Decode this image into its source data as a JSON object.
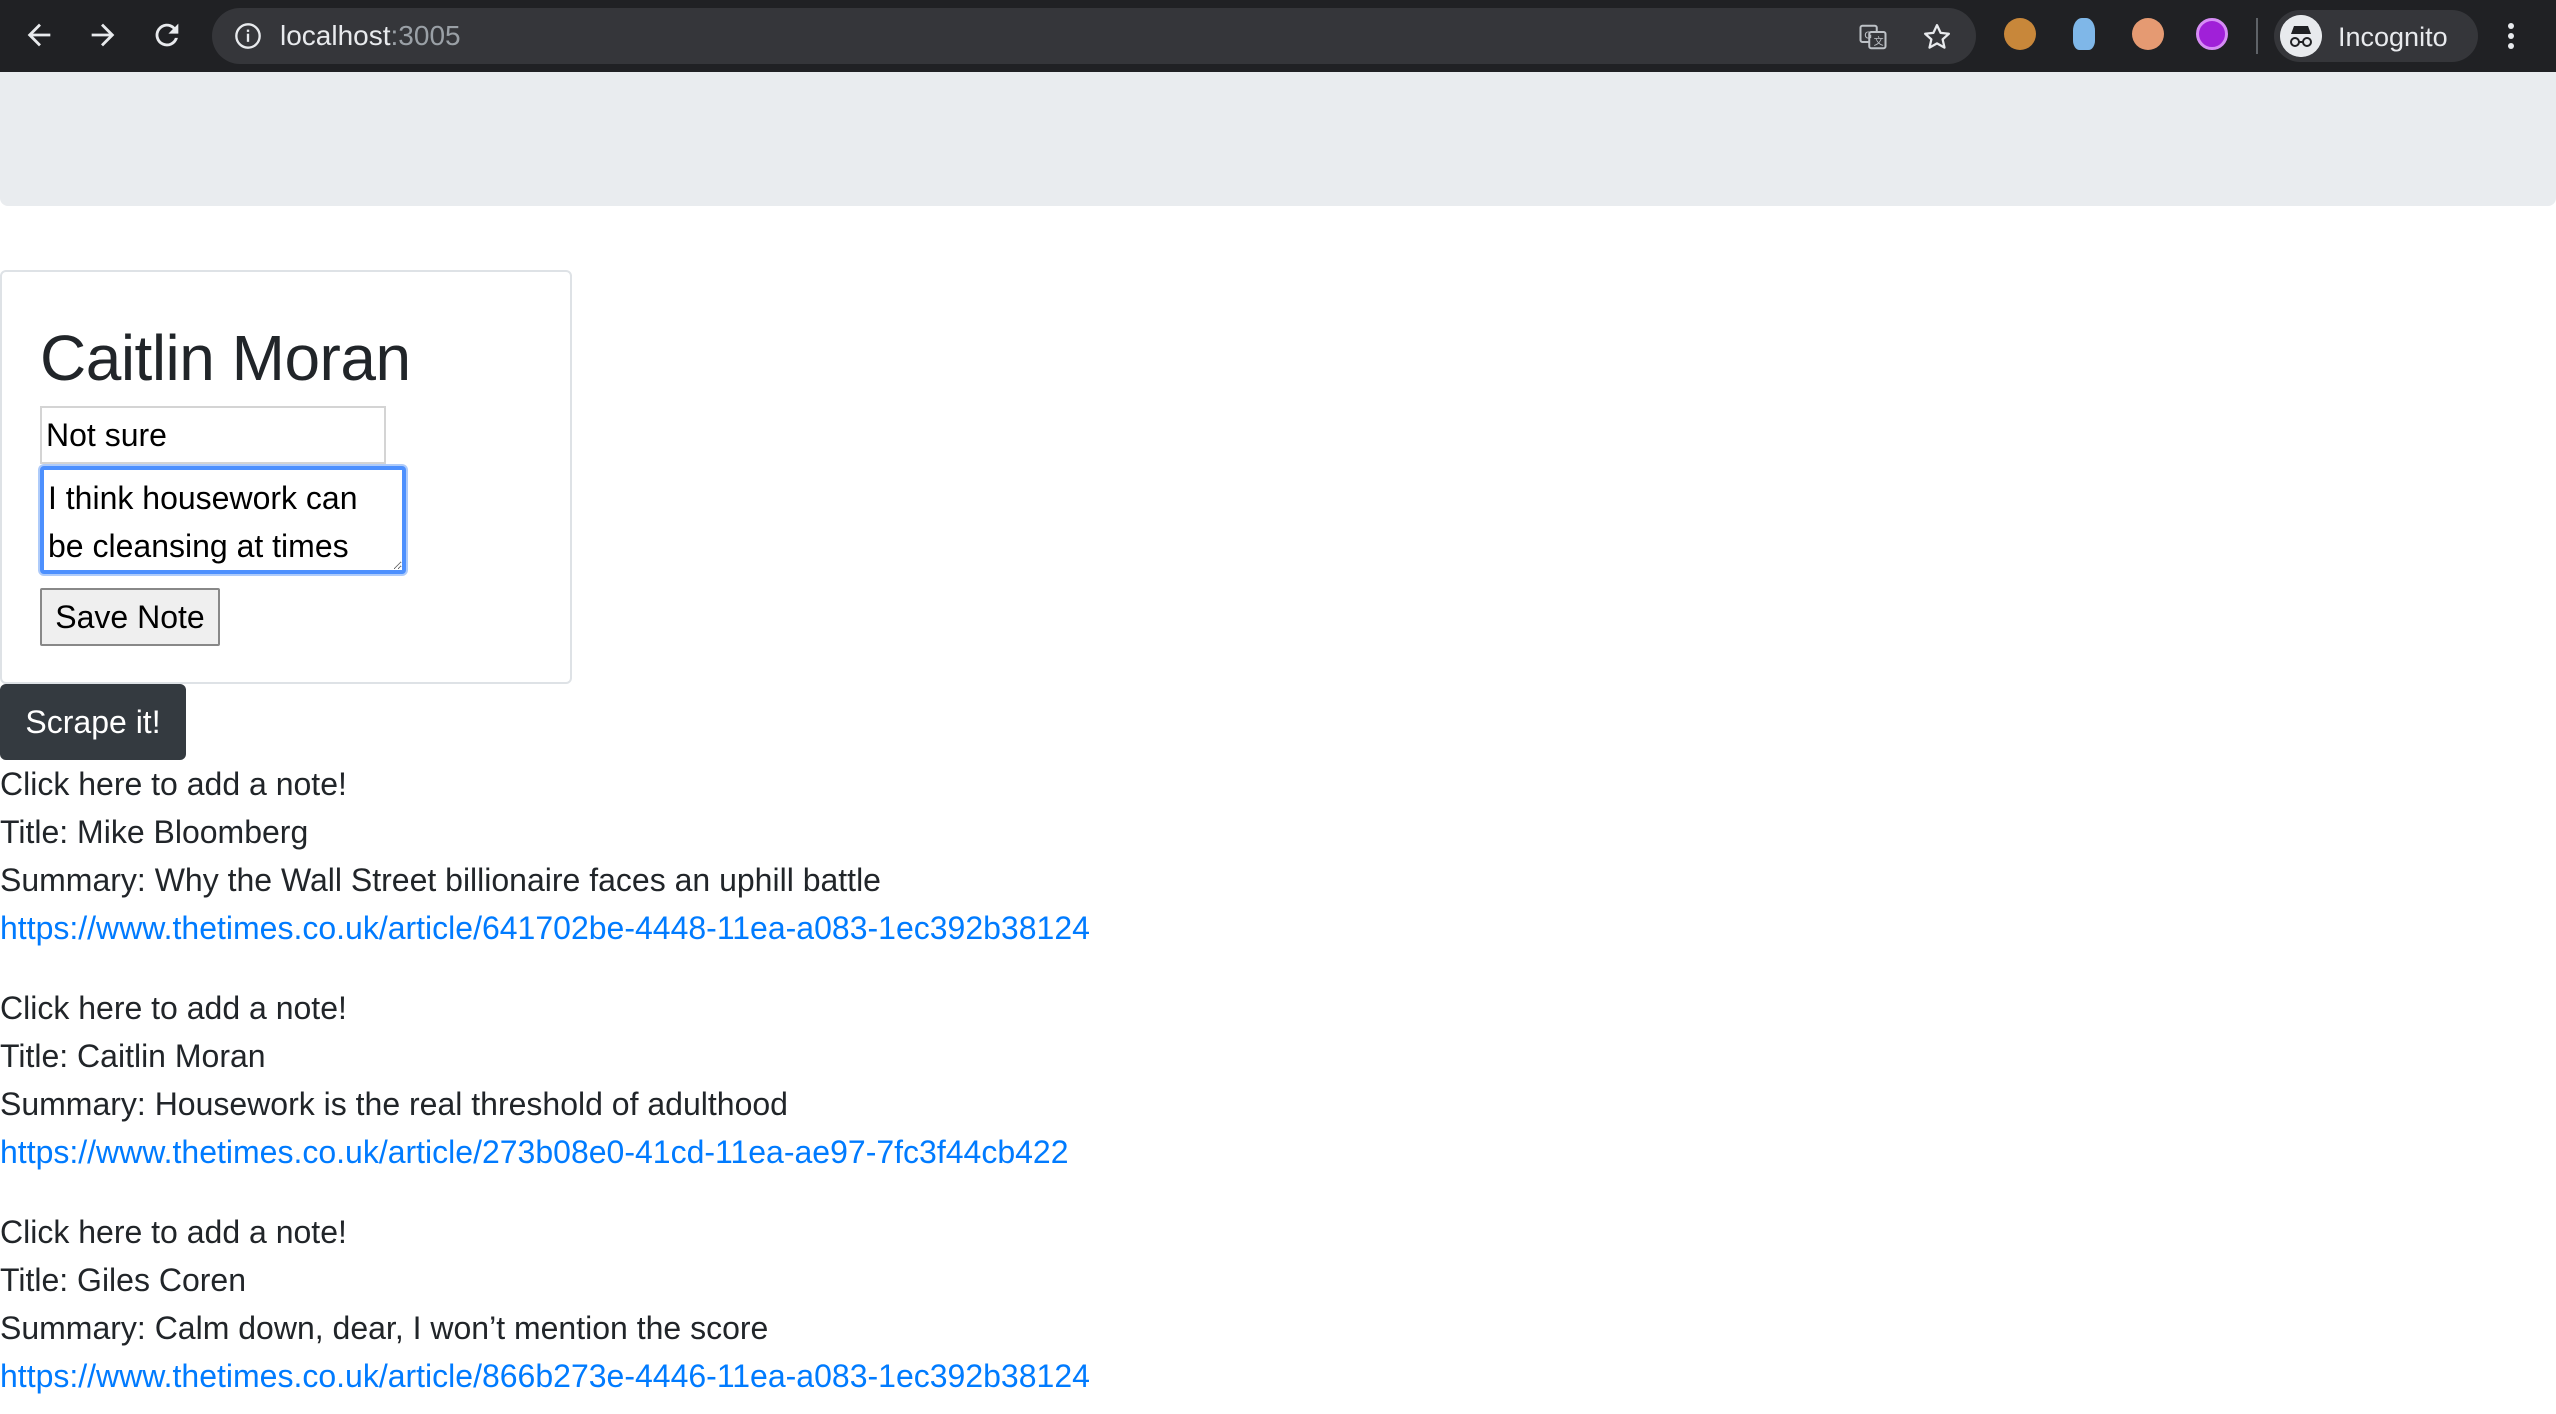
{
  "browser": {
    "url_host": "localhost",
    "url_port": ":3005",
    "profile_label": "Incognito",
    "icons": [
      "back-icon",
      "forward-icon",
      "reload-icon",
      "info-icon",
      "translate-icon",
      "star-icon",
      "cookie-extension-icon",
      "lightbulb-extension-icon",
      "brain-extension-icon",
      "purple-extension-icon",
      "incognito-icon",
      "menu-icon"
    ]
  },
  "note_card": {
    "title": "Caitlin Moran",
    "title_input_value": "Not sure",
    "body_value": "I think housework can be cleansing at times",
    "save_label": "Save Note"
  },
  "scrape_label": "Scrape it!",
  "articles": [
    {
      "prompt": "Click here to add a note!",
      "title": "Title: Mike Bloomberg",
      "summary": "Summary: Why the Wall Street billionaire faces an uphill battle",
      "link": "https://www.thetimes.co.uk/article/641702be-4448-11ea-a083-1ec392b38124"
    },
    {
      "prompt": "Click here to add a note!",
      "title": "Title: Caitlin Moran",
      "summary": "Summary: Housework is the real threshold of adulthood",
      "link": "https://www.thetimes.co.uk/article/273b08e0-41cd-11ea-ae97-7fc3f44cb422"
    },
    {
      "prompt": "Click here to add a note!",
      "title": "Title: Giles Coren",
      "summary": "Summary: Calm down, dear, I won’t mention the score",
      "link": "https://www.thetimes.co.uk/article/866b273e-4446-11ea-a083-1ec392b38124"
    }
  ],
  "colors": {
    "chrome_bg": "#202124",
    "jumbotron_bg": "#e9ecef",
    "scrape_button_bg": "#343a40",
    "link": "#007bff",
    "focus_ring": "#4d90fe"
  }
}
